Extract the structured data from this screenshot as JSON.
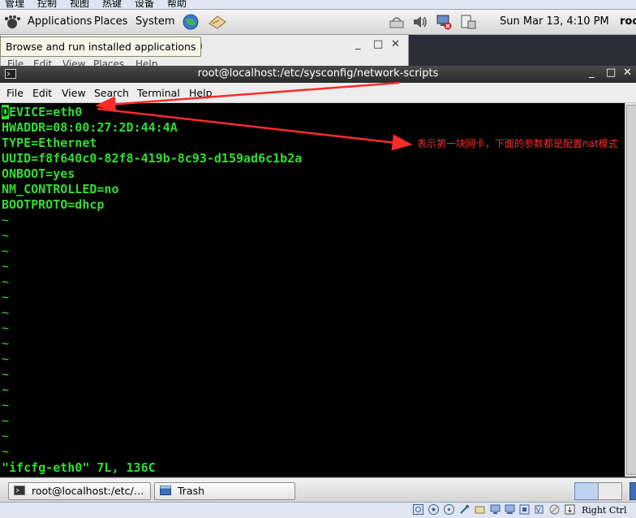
{
  "host_menu": {
    "items": [
      "管理",
      "控制",
      "视图",
      "热键",
      "设备",
      "帮助"
    ]
  },
  "top_panel": {
    "menus": [
      "Applications",
      "Places",
      "System"
    ],
    "clock": "Sun Mar 13,  4:10 PM",
    "user": "roo"
  },
  "tooltip": "Browse and run installed applications",
  "background_window": {
    "title_fragment": "ash",
    "menu_fragment": [
      "File",
      "Edit",
      "View",
      "Places",
      "Help"
    ]
  },
  "terminal": {
    "title": "root@localhost:/etc/sysconfig/network-scripts",
    "menu": [
      "File",
      "Edit",
      "View",
      "Search",
      "Terminal",
      "Help"
    ],
    "first_char": "D",
    "first_rest": "EVICE=eth0",
    "lines": [
      "HWADDR=08:00:27:2D:44:4A",
      "TYPE=Ethernet",
      "UUID=f8f640c0-82f8-419b-8c93-d159ad6c1b2a",
      "ONBOOT=yes",
      "NM_CONTROLLED=no",
      "BOOTPROTO=dhcp"
    ],
    "tilde": "~",
    "status_line": "\"ifcfg-eth0\" 7L, 136C"
  },
  "annotation": "表示第一块网卡，下面的参数都是配置nat模式",
  "taskbar": {
    "tasks": [
      "root@localhost:/etc/…",
      "Trash"
    ]
  },
  "vbox_status": {
    "host_key": "Right Ctrl"
  },
  "colors": {
    "terminal_fg": "#33dd33",
    "terminal_bg": "#000000",
    "annotation": "#ff2a2a"
  }
}
